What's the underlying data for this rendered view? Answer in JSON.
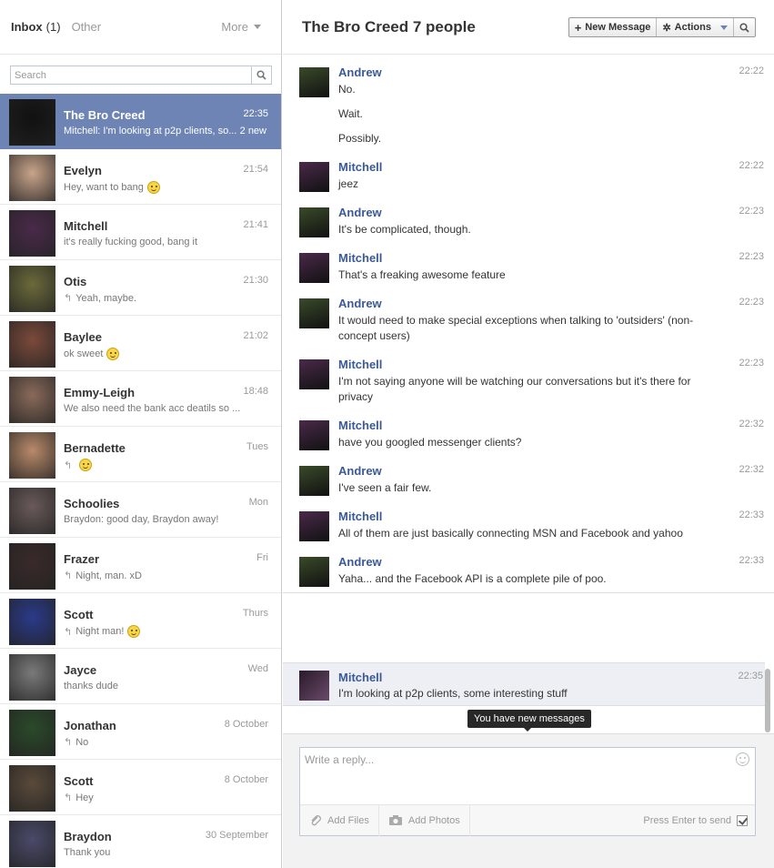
{
  "left": {
    "inbox_label": "Inbox",
    "inbox_count": "(1)",
    "other_label": "Other",
    "more_label": "More",
    "search_placeholder": "Search"
  },
  "threads": [
    {
      "name": "The Bro Creed",
      "time": "22:35",
      "snippet": "Mitchell: I'm looking at p2p clients, so...",
      "new": "2 new",
      "active": true,
      "avatar_color": "#111111"
    },
    {
      "name": "Evelyn",
      "time": "21:54",
      "snippet": "Hey, want to bang",
      "emoji": true,
      "avatar_color": "#c9a48a"
    },
    {
      "name": "Mitchell",
      "time": "21:41",
      "snippet": "it's really fucking good, bang it",
      "avatar_color": "#4a2a4a"
    },
    {
      "name": "Otis",
      "time": "21:30",
      "snippet": "Yeah, maybe.",
      "reply": true,
      "avatar_color": "#6b6a3a"
    },
    {
      "name": "Baylee",
      "time": "21:02",
      "snippet": "ok sweet",
      "emoji": true,
      "avatar_color": "#7b4a3a"
    },
    {
      "name": "Emmy-Leigh",
      "time": "18:48",
      "snippet": "We also need the bank acc deatils so ...",
      "avatar_color": "#8a6a5a"
    },
    {
      "name": "Bernadette",
      "time": "Tues",
      "snippet": "",
      "reply": true,
      "emoji": true,
      "avatar_color": "#b98a6a"
    },
    {
      "name": "Schoolies",
      "time": "Mon",
      "snippet": "Braydon: good day, Braydon away!",
      "avatar_color": "#6a5a5a"
    },
    {
      "name": "Frazer",
      "time": "Fri",
      "snippet": "Night, man. xD",
      "reply": true,
      "avatar_color": "#3a2a2a"
    },
    {
      "name": "Scott",
      "time": "Thurs",
      "snippet": "Night man!",
      "reply": true,
      "emoji": true,
      "avatar_color": "#2a3a8a"
    },
    {
      "name": "Jayce",
      "time": "Wed",
      "snippet": "thanks dude",
      "avatar_color": "#7a7a7a"
    },
    {
      "name": "Jonathan",
      "time": "8 October",
      "snippet": "No",
      "reply": true,
      "avatar_color": "#2a4a2a"
    },
    {
      "name": "Scott",
      "time": "8 October",
      "snippet": "Hey",
      "reply": true,
      "avatar_color": "#5a4a3a"
    },
    {
      "name": "Braydon",
      "time": "30 September",
      "snippet": "Thank you",
      "avatar_color": "#4a4a6a"
    }
  ],
  "conversation": {
    "title": "The Bro Creed 7 people",
    "new_message": "New Message",
    "actions": "Actions"
  },
  "messages": [
    {
      "author": "Andrew",
      "time": "22:22",
      "lines": [
        "No.",
        "Wait.",
        "Possibly."
      ],
      "avatar_color": "#3a4a2a"
    },
    {
      "author": "Mitchell",
      "time": "22:22",
      "lines": [
        "jeez"
      ],
      "avatar_color": "#4a2a4a"
    },
    {
      "author": "Andrew",
      "time": "22:23",
      "lines": [
        "It's be complicated, though."
      ],
      "avatar_color": "#3a4a2a"
    },
    {
      "author": "Mitchell",
      "time": "22:23",
      "lines": [
        "That's a freaking awesome feature"
      ],
      "avatar_color": "#4a2a4a"
    },
    {
      "author": "Andrew",
      "time": "22:23",
      "lines": [
        "It would need to make special exceptions when talking to 'outsiders' (non-concept users)"
      ],
      "avatar_color": "#3a4a2a"
    },
    {
      "author": "Mitchell",
      "time": "22:23",
      "lines": [
        "I'm not saying anyone will be watching our conversations but it's there for privacy"
      ],
      "avatar_color": "#4a2a4a"
    },
    {
      "author": "Mitchell",
      "time": "22:32",
      "lines": [
        "have you googled messenger clients?"
      ],
      "avatar_color": "#4a2a4a"
    },
    {
      "author": "Andrew",
      "time": "22:32",
      "lines": [
        "I've seen a fair few."
      ],
      "avatar_color": "#3a4a2a"
    },
    {
      "author": "Mitchell",
      "time": "22:33",
      "lines": [
        "All of them are just basically connecting MSN and Facebook and yahoo"
      ],
      "avatar_color": "#4a2a4a"
    },
    {
      "author": "Andrew",
      "time": "22:33",
      "lines": [
        "Yaha... and the Facebook API is a complete pile of poo."
      ],
      "avatar_color": "#3a4a2a"
    }
  ],
  "latest": {
    "author": "Mitchell",
    "time": "22:35",
    "text": "I'm looking at p2p clients, some interesting stuff"
  },
  "tooltip": "You have new messages",
  "composer": {
    "placeholder": "Write a reply...",
    "add_files": "Add Files",
    "add_photos": "Add Photos",
    "press_enter": "Press Enter to send"
  },
  "colors": {
    "accent": "#3b5998",
    "active_thread": "#6d84b4"
  }
}
